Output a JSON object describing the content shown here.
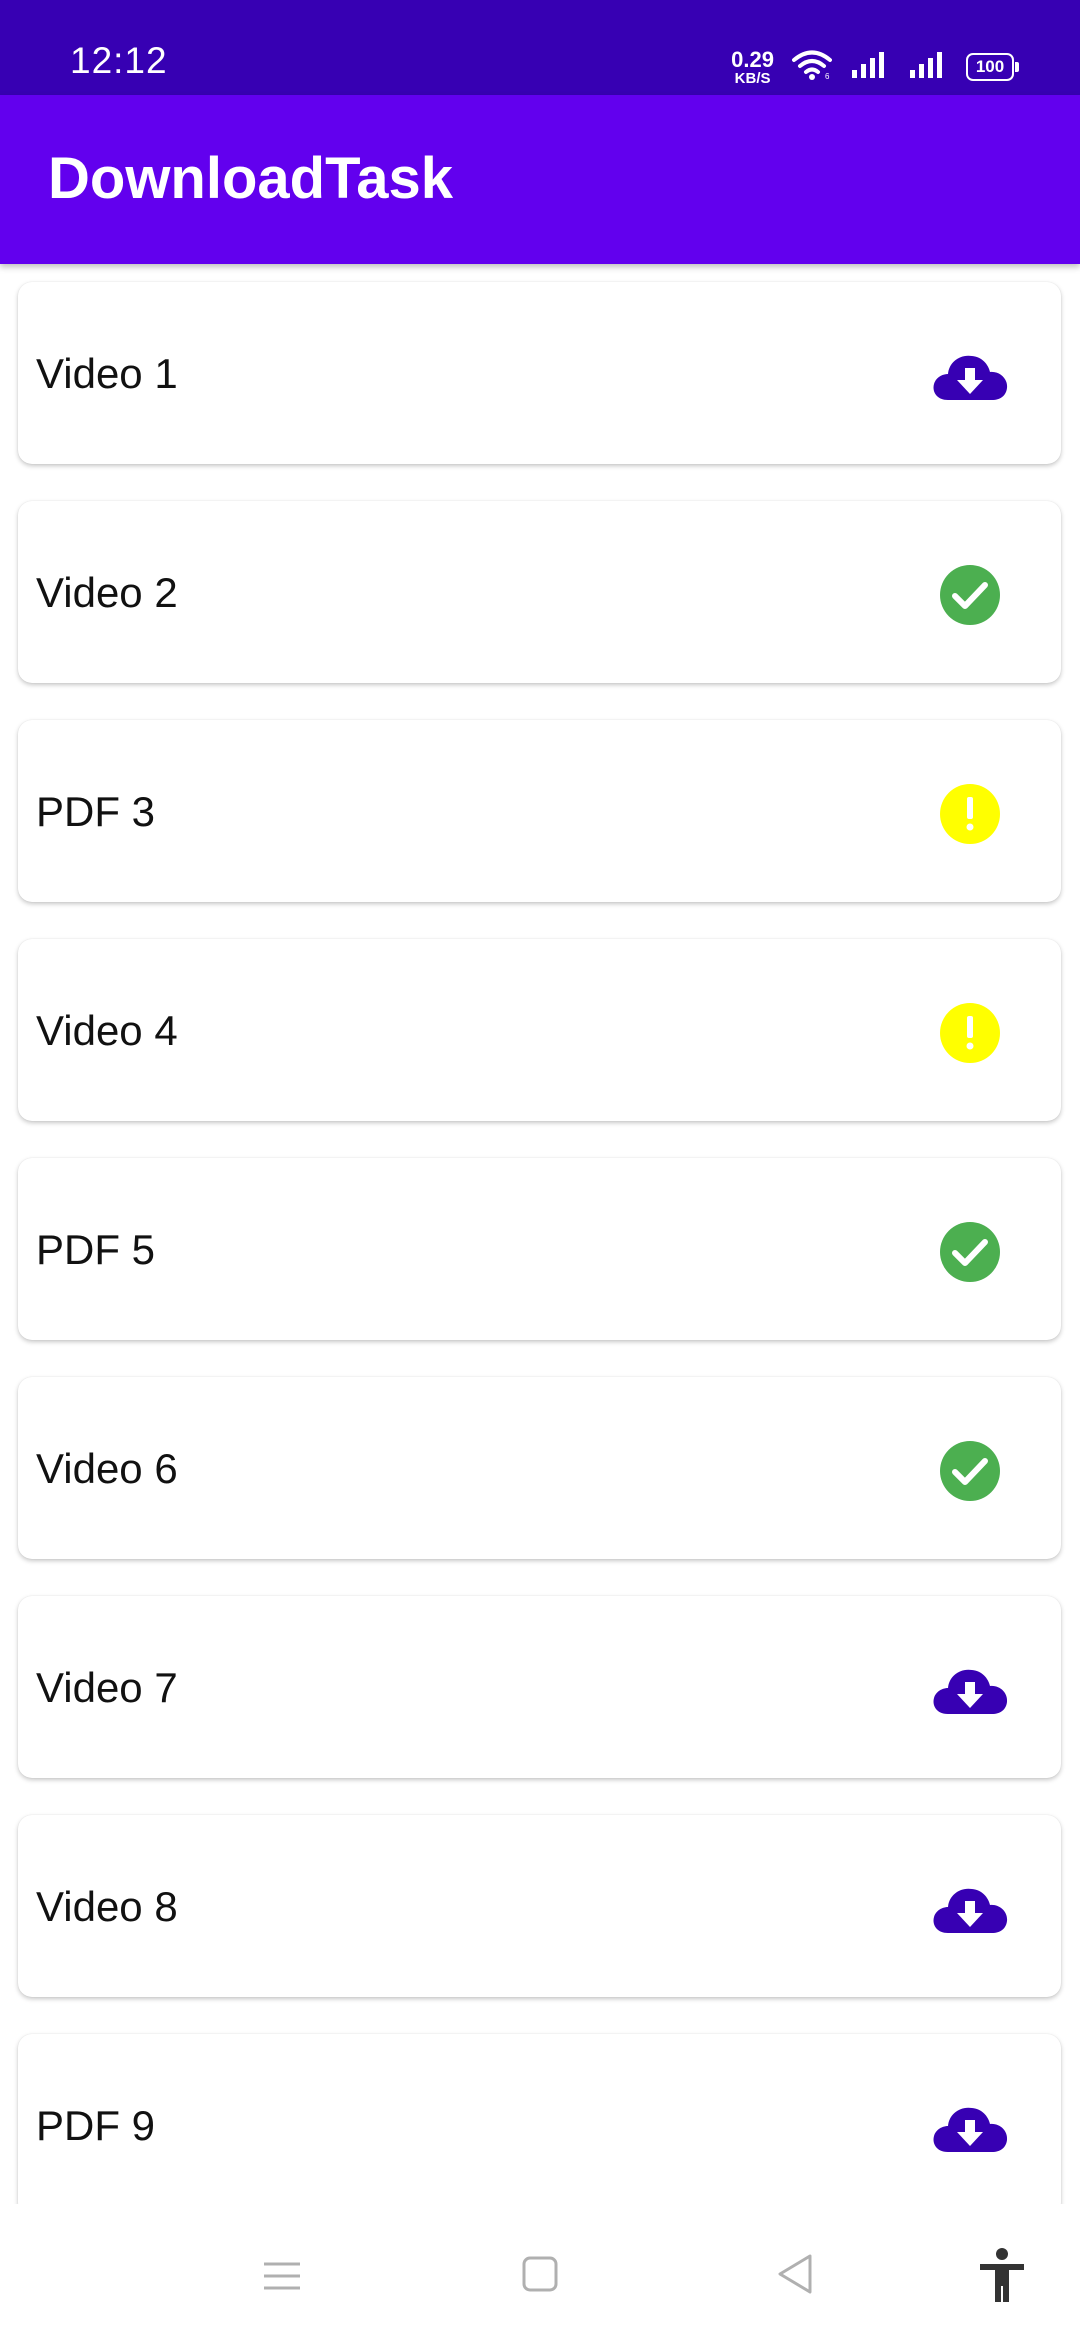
{
  "status_bar": {
    "time": "12:12",
    "net_speed_value": "0.29",
    "net_speed_unit": "KB/S",
    "battery": "100",
    "icons": [
      "wifi-icon",
      "signal-icon",
      "signal-icon",
      "battery-icon"
    ]
  },
  "app_bar": {
    "title": "DownloadTask"
  },
  "colors": {
    "status_bar": "#3700b3",
    "app_bar": "#6200ee",
    "download_icon": "#3700b3",
    "done_icon": "#4caf50",
    "warning_icon": "#ffff00"
  },
  "items": [
    {
      "label": "Video 1",
      "status_icon": "cloud-download-icon"
    },
    {
      "label": "Video 2",
      "status_icon": "check-circle-icon"
    },
    {
      "label": "PDF 3",
      "status_icon": "warning-circle-icon"
    },
    {
      "label": "Video 4",
      "status_icon": "warning-circle-icon"
    },
    {
      "label": "PDF 5",
      "status_icon": "check-circle-icon"
    },
    {
      "label": "Video 6",
      "status_icon": "check-circle-icon"
    },
    {
      "label": "Video 7",
      "status_icon": "cloud-download-icon"
    },
    {
      "label": "Video 8",
      "status_icon": "cloud-download-icon"
    },
    {
      "label": "PDF 9",
      "status_icon": "cloud-download-icon"
    }
  ],
  "nav_bar": {
    "icons": [
      "menu-icon",
      "home-icon",
      "back-icon",
      "accessibility-icon"
    ]
  }
}
